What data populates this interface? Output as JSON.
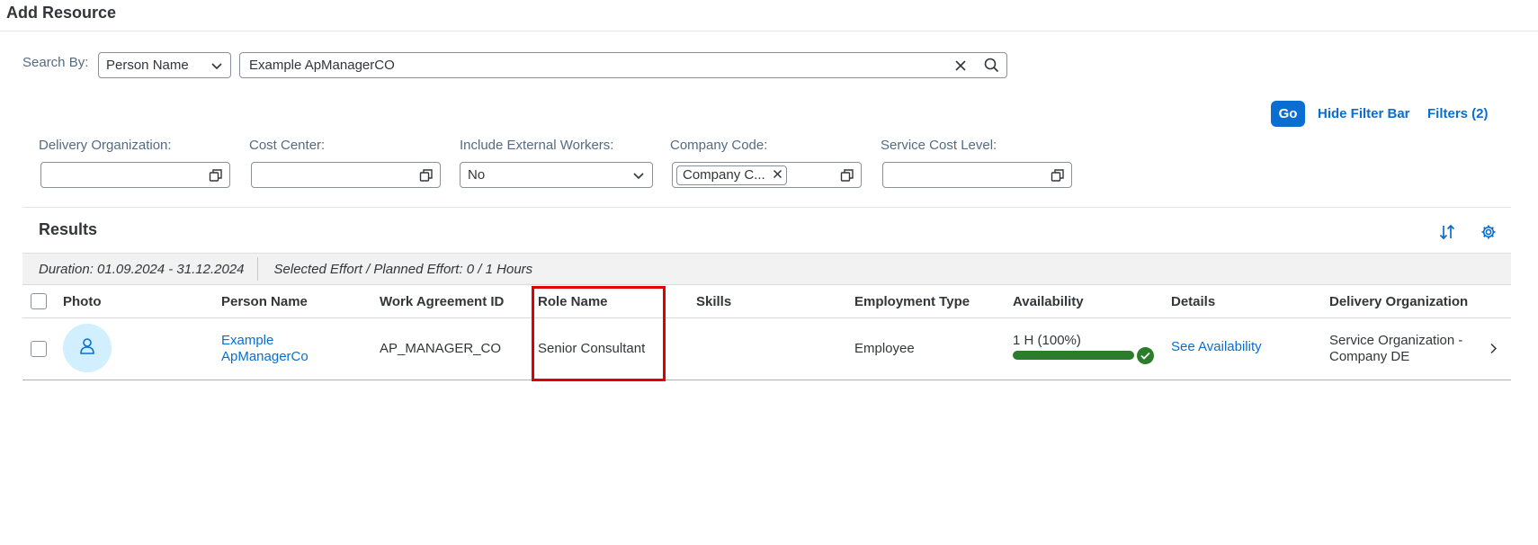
{
  "header": {
    "title": "Add Resource"
  },
  "search": {
    "label": "Search By:",
    "by_value": "Person Name",
    "query": "Example ApManagerCO"
  },
  "filter_bar": {
    "go": "Go",
    "hide": "Hide Filter Bar",
    "filters": "Filters (2)",
    "fields": [
      {
        "label": "Delivery Organization:",
        "value": ""
      },
      {
        "label": "Cost Center:",
        "value": ""
      },
      {
        "label": "Include External Workers:",
        "value": "No"
      },
      {
        "label": "Company Code:",
        "token": "Company C..."
      },
      {
        "label": "Service Cost Level:",
        "value": ""
      }
    ]
  },
  "results": {
    "title": "Results",
    "duration": "Duration: 01.09.2024 - 31.12.2024",
    "effort": "Selected Effort / Planned Effort: 0 / 1 Hours",
    "columns": [
      "Photo",
      "Person Name",
      "Work Agreement ID",
      "Role Name",
      "Skills",
      "Employment Type",
      "Availability",
      "Details",
      "Delivery Organization"
    ],
    "rows": [
      {
        "person_name_1": "Example",
        "person_name_2": "ApManagerCo",
        "work_agreement_id": "AP_MANAGER_CO",
        "role_name": "Senior Consultant",
        "skills": "",
        "employment_type": "Employee",
        "availability": "1 H (100%)",
        "availability_fraction": 1.0,
        "details": "See Availability",
        "delivery_org_1": "Service Organization -",
        "delivery_org_2": "Company DE"
      }
    ]
  },
  "colors": {
    "accent": "#0a6ed1",
    "success": "#2b7d2b",
    "highlight": "#e00000",
    "avatar_bg": "#d1efff"
  }
}
